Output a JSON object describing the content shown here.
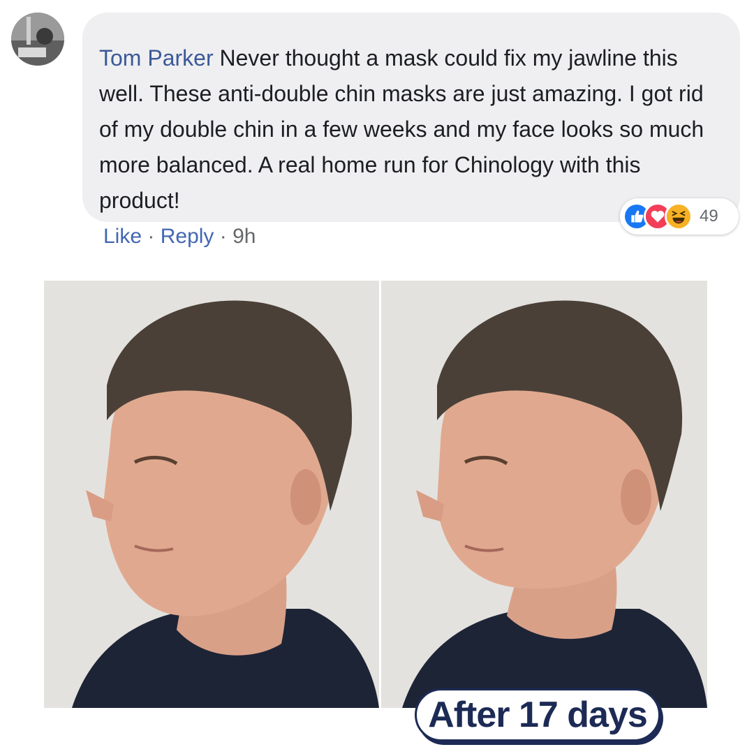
{
  "comment": {
    "author": "Tom Parker",
    "text": "Never thought a mask could fix my jawline this well. These anti-double chin masks are just amazing. I got rid of my double chin in a few weeks and my face looks so much more balanced. A real home run for Chinology with this product!",
    "reactions": {
      "icons": [
        "like-icon",
        "love-icon",
        "haha-icon"
      ],
      "count": "49",
      "colors": {
        "like": "#1877f2",
        "love": "#f33e58",
        "haha": "#f7b125"
      }
    },
    "actions": {
      "like": "Like",
      "reply": "Reply",
      "separator": "·",
      "time": "9h"
    }
  },
  "photos": {
    "after_label": "After 17 days"
  },
  "colors": {
    "author": "#3b5998",
    "link": "#4267b2",
    "bubble": "#efeff1",
    "badge": "#1c2a55"
  }
}
